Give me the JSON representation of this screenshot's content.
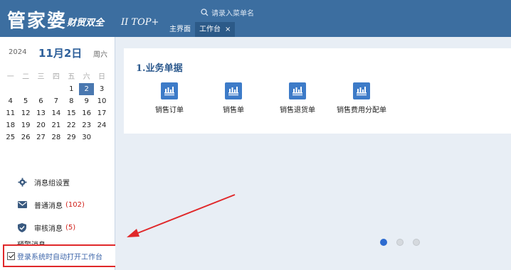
{
  "app": {
    "logo_main": "管家婆",
    "logo_sub": "财贸双全",
    "logo_edition": "II TOP+"
  },
  "search": {
    "placeholder": "请录入菜单名"
  },
  "tabs": [
    {
      "label": "主界面"
    },
    {
      "label": "工作台",
      "close": "×"
    }
  ],
  "calendar": {
    "year": "2024",
    "date": "11月2日",
    "weekday": "周六",
    "weekday_headers": [
      "一",
      "二",
      "三",
      "四",
      "五",
      "六",
      "日"
    ],
    "weeks": [
      [
        "",
        "",
        "",
        "",
        "1",
        "2",
        "3"
      ],
      [
        "4",
        "5",
        "6",
        "7",
        "8",
        "9",
        "10"
      ],
      [
        "11",
        "12",
        "13",
        "14",
        "15",
        "16",
        "17"
      ],
      [
        "18",
        "19",
        "20",
        "21",
        "22",
        "23",
        "24"
      ],
      [
        "25",
        "26",
        "27",
        "28",
        "29",
        "30",
        ""
      ]
    ],
    "today": "2"
  },
  "messages": {
    "settings_label": "消息组设置",
    "normal_label": "普通消息",
    "normal_count": "(102)",
    "audit_label": "审核消息",
    "audit_count": "(5)",
    "partial_label": "预警消息"
  },
  "auto_open": {
    "label": "登录系统时自动打开工作台",
    "checked": true
  },
  "workspace": {
    "section_title": "1.业务单据",
    "functions": [
      {
        "label": "销售订单",
        "icon": "document-icon"
      },
      {
        "label": "销售单",
        "icon": "document-icon"
      },
      {
        "label": "销售退货单",
        "icon": "document-icon"
      },
      {
        "label": "销售费用分配单",
        "icon": "document-icon"
      }
    ]
  },
  "pager": {
    "pages": 3,
    "active": 1
  },
  "colors": {
    "header": "#3c6ea0",
    "tab_active": "#2c5a88",
    "accent": "#2d6bd0",
    "highlight_box": "#e0282a",
    "count_red": "#d0201a"
  }
}
